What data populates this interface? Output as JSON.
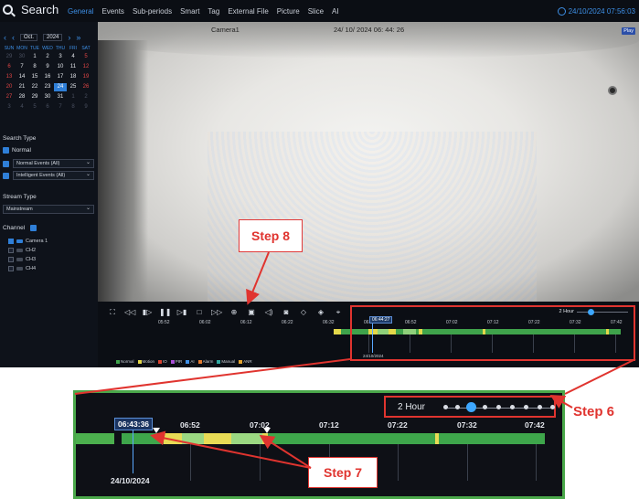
{
  "header": {
    "title": "Search",
    "tabs": [
      "General",
      "Events",
      "Sub-periods",
      "Smart",
      "Tag",
      "External File",
      "Picture",
      "Slice",
      "AI"
    ],
    "datetime": "24/10/2024 07:56:03"
  },
  "calendar": {
    "month": "Oct.",
    "year": "2024",
    "weekdays": [
      "SUN",
      "MON",
      "TUE",
      "WED",
      "THU",
      "FRI",
      "SAT"
    ],
    "days": [
      "29",
      "30",
      "1",
      "2",
      "3",
      "4",
      "5",
      "6",
      "7",
      "8",
      "9",
      "10",
      "11",
      "12",
      "13",
      "14",
      "15",
      "16",
      "17",
      "18",
      "19",
      "20",
      "21",
      "22",
      "23",
      "24",
      "25",
      "26",
      "27",
      "28",
      "29",
      "30",
      "31",
      "1",
      "2",
      "3",
      "4",
      "5",
      "6",
      "7",
      "8",
      "9"
    ],
    "selected_day": "24"
  },
  "search_type": {
    "label": "Search Type",
    "normal": "Normal",
    "normal_events": "Normal Events (All)",
    "intelligent_events": "Intelligent Events (All)"
  },
  "stream_type": {
    "label": "Stream Type",
    "value": "Mainstream"
  },
  "channel": {
    "label": "Channel",
    "cameras": [
      "Camera 1",
      "CH2",
      "CH3",
      "CH4"
    ]
  },
  "video": {
    "camera_name": "Camera1",
    "osd_time": "24/ 10/ 2024  06: 44: 26",
    "play_label": "Play"
  },
  "timeline": {
    "zoom_label": "2 Hour",
    "ticks": [
      "05:52",
      "06:02",
      "06:12",
      "06:22",
      "06:32",
      "06:42",
      "06:52",
      "07:02",
      "07:12",
      "07:22",
      "07:32",
      "07:42"
    ],
    "cursor_time": "06:44:27",
    "date": "24/10/2024",
    "legend": [
      "Normal",
      "Motion",
      "IO",
      "PIR",
      "AI",
      "Alarm",
      "Manual",
      "ANR"
    ],
    "legend_colors": [
      "#3fa34b",
      "#e3d84a",
      "#d8412f",
      "#a84fd6",
      "#3d8fe6",
      "#e07a2f",
      "#2fa7a0",
      "#e0a22f"
    ]
  },
  "zoomed_timeline": {
    "zoom_label": "2 Hour",
    "cursor_time": "06:43:36",
    "ticks": [
      "06:52",
      "07:02",
      "07:12",
      "07:22",
      "07:32",
      "07:42"
    ],
    "date": "24/10/2024"
  },
  "annotations": {
    "step6": "Step 6",
    "step7": "Step 7",
    "step8": "Step 8"
  }
}
